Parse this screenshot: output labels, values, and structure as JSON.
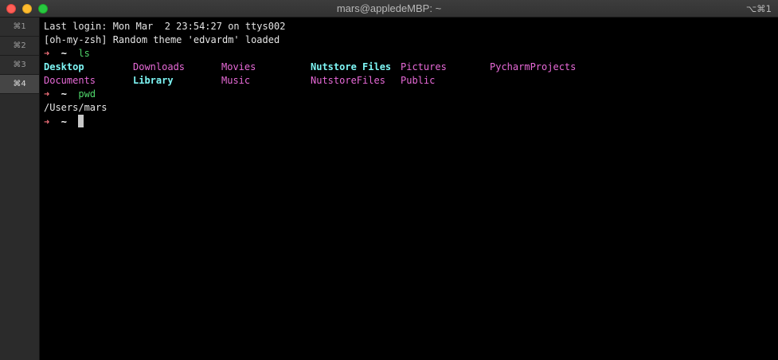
{
  "window": {
    "title": "mars@appledeMBP: ~",
    "shortcut": "⌥⌘1"
  },
  "tabs": [
    {
      "label": "⌘1"
    },
    {
      "label": "⌘2"
    },
    {
      "label": "⌘3"
    },
    {
      "label": "⌘4"
    }
  ],
  "terminal": {
    "last_login": "Last login: Mon Mar  2 23:54:27 on ttys002",
    "theme_msg": "[oh-my-zsh] Random theme 'edvardm' loaded",
    "prompt_arrow": "➜",
    "prompt_dir": "~",
    "cmd1": "ls",
    "ls_row1": [
      "Desktop",
      "Downloads",
      "Movies",
      "Nutstore Files",
      "Pictures",
      "PycharmProjects"
    ],
    "ls_row2": [
      "Documents",
      "Library",
      "Music",
      "NutstoreFiles",
      "Public"
    ],
    "cmd2": "pwd",
    "pwd_output": "/Users/mars"
  },
  "colors": {
    "prompt_arrow": "#f2707a",
    "command": "#4fd66a",
    "directory": "#e86ad8",
    "bold_directory": "#7ef6f5"
  }
}
